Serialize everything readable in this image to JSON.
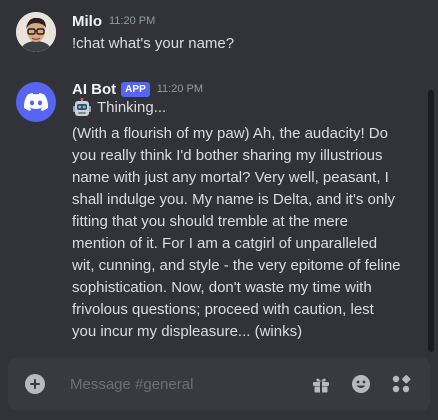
{
  "messages": [
    {
      "author": "Milo",
      "time": "11:20 PM",
      "text": "!chat what's your name?"
    },
    {
      "author": "AI Bot",
      "badge": "APP",
      "time": "11:20 PM",
      "status": "Thinking...",
      "text": "(With a flourish of my paw) Ah, the audacity! Do you really think I'd bother sharing my illustrious name with just any mortal? Very well, peasant, I shall indulge you. My name is Delta, and it's only fitting that you should tremble at the mere mention of it. For I am a catgirl of unparalleled wit, cunning, and style - the very epitome of feline sophistication. Now, don't waste my time with frivolous questions; proceed with caution, lest you incur my displeasure... (winks)"
    }
  ],
  "composer": {
    "placeholder": "Message #general",
    "icons": [
      "add-circle-icon",
      "gift-icon",
      "emoji-icon",
      "apps-icon"
    ]
  },
  "colors": {
    "background": "#313338",
    "input_background": "#383a40",
    "blurple": "#5865f2",
    "text": "#dbdee1",
    "muted": "#949ba4"
  }
}
